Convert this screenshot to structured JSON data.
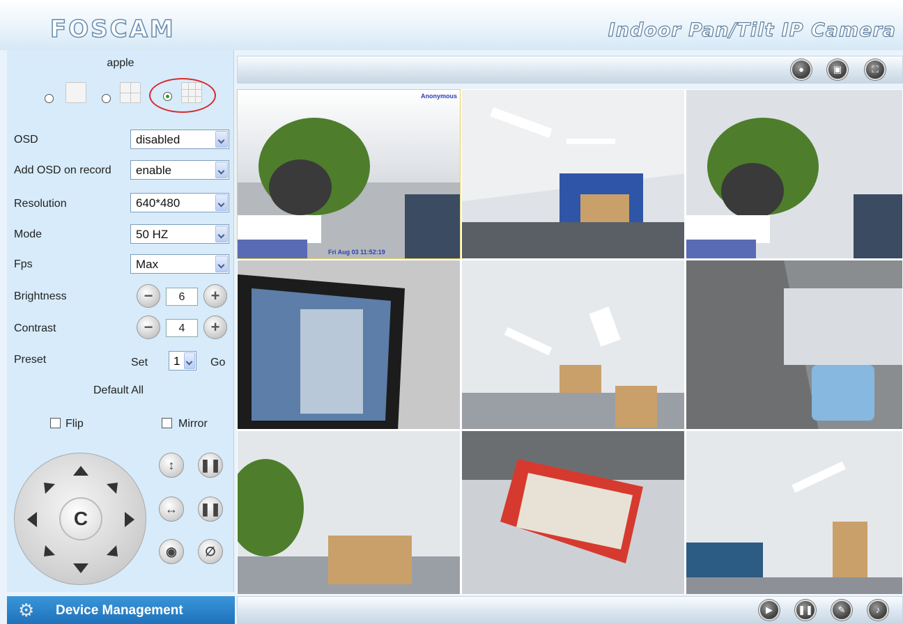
{
  "header": {
    "logo": "FOSCAM",
    "product_title": "Indoor Pan/Tilt IP Camera"
  },
  "left_panel": {
    "device_name": "apple",
    "layout_options": [
      {
        "name": "1 camera",
        "selected": false
      },
      {
        "name": "4 cameras",
        "selected": false
      },
      {
        "name": "9 cameras",
        "selected": true
      }
    ],
    "settings": {
      "osd": {
        "label": "OSD",
        "value": "disabled"
      },
      "add_osd_on_record": {
        "label": "Add OSD on record",
        "value": "enable"
      },
      "resolution": {
        "label": "Resolution",
        "value": "640*480"
      },
      "mode": {
        "label": "Mode",
        "value": "50 HZ"
      },
      "fps": {
        "label": "Fps",
        "value": "Max"
      },
      "brightness": {
        "label": "Brightness",
        "value": "6"
      },
      "contrast": {
        "label": "Contrast",
        "value": "4"
      },
      "preset": {
        "label": "Preset",
        "set_label": "Set",
        "value": "1",
        "go_label": "Go"
      }
    },
    "default_all": "Default All",
    "flip": {
      "label": "Flip",
      "checked": false
    },
    "mirror": {
      "label": "Mirror",
      "checked": false
    },
    "ptz": {
      "center_label": "C"
    }
  },
  "bottom_menu": {
    "device_management": "Device Management"
  },
  "top_toolbar": {
    "buttons": [
      "record-icon",
      "snapshot-icon",
      "fullscreen-icon"
    ]
  },
  "bottom_toolbar": {
    "buttons": [
      "play-icon",
      "pause-icon",
      "microphone-icon",
      "speaker-icon"
    ]
  },
  "video_grid": {
    "layout": "3x3",
    "cell_count": 9,
    "cell1_osd_top": "Anonymous",
    "cell1_osd_bottom": "Fri Aug 03 11:52:19"
  },
  "colors": {
    "panel_bg": "#d7ebfa",
    "menu_blue": "#1f72bb",
    "highlight_red": "#d92a2a"
  }
}
